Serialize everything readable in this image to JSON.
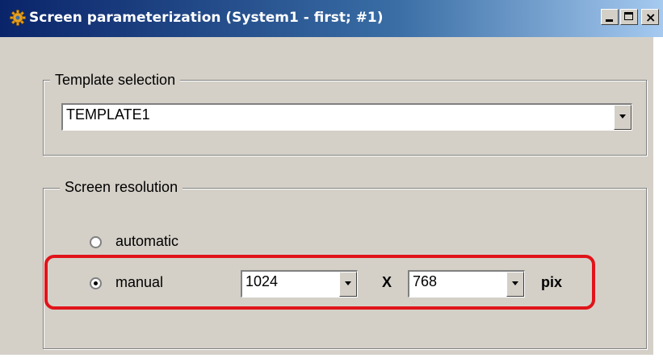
{
  "window": {
    "title": "Screen parameterization (System1 - first; #1)",
    "icon": "gear-icon",
    "controls": [
      "minimize-icon",
      "maximize-icon",
      "close-icon"
    ]
  },
  "template_selection": {
    "legend": "Template selection",
    "selected": "TEMPLATE1"
  },
  "screen_resolution": {
    "legend": "Screen resolution",
    "options": [
      {
        "label": "automatic",
        "checked": false
      },
      {
        "label": "manual",
        "checked": true
      }
    ],
    "width": "1024",
    "separator": "X",
    "height": "768",
    "unit": "pix"
  },
  "colors": {
    "titlebar_start": "#0a246a",
    "titlebar_end": "#a6caf0",
    "dialog_bg": "#d4d0c8",
    "highlight": "#e0141a"
  }
}
